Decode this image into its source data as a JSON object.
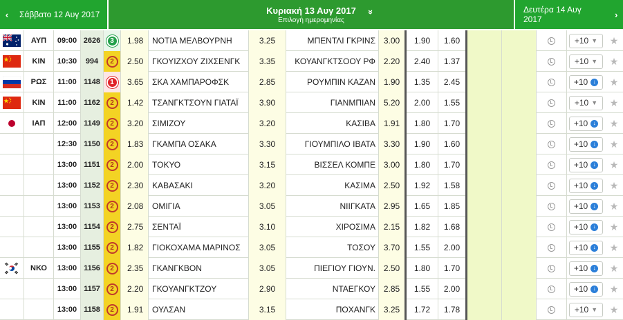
{
  "header": {
    "prev_label": "Σάββατο 12 Αυγ 2017",
    "prev_arrow": "‹",
    "center_title": "Κυριακή 13 Αυγ 2017",
    "center_sub": "Επιλογή ημερομηνίας",
    "center_toggle": "»",
    "next_label": "Δευτέρα 14 Αυγ 2017",
    "next_arrow": "›"
  },
  "colors": {
    "header_green": "#21a52f",
    "badge_yellow": "#f3d324",
    "badge_red": "#e0242a",
    "badge_green": "#22a04a",
    "odd_bg": "#fdfde4",
    "extra_bg": "#f0f9c8",
    "button_blue": "#2b7fd9"
  },
  "rows": [
    {
      "flag": "au-flag-icon",
      "country": "ΑΥΠ",
      "time": "09:00",
      "code": "2626",
      "badge": "3",
      "badge_color": "green",
      "odd1": "1.98",
      "home": "ΝΟΤΙΑ ΜΕΛΒΟΥΡΝΗ",
      "draw": "3.25",
      "away": "ΜΠΕΝΤΛΙ ΓΚΡΙΝΣ",
      "odd2": "3.00",
      "dc1": "1.90",
      "dc2": "1.60",
      "more": "+10",
      "more_icon": "chevron-down-icon"
    },
    {
      "flag": "cn-flag-icon",
      "country": "ΚΙΝ",
      "time": "10:30",
      "code": "994",
      "badge": "2",
      "badge_color": "yellow",
      "odd1": "2.50",
      "home": "ΓΚΟΥΙΖΧΟΥ ΖΙΧΣΕΝΓΚ",
      "draw": "3.35",
      "away": "ΚΟΥΑΝΓΚΤΣΟΟΥ ΡΦ",
      "odd2": "2.20",
      "dc1": "2.40",
      "dc2": "1.37",
      "more": "+10",
      "more_icon": "chevron-down-icon"
    },
    {
      "flag": "ru-flag-icon",
      "country": "ΡΩΣ",
      "time": "11:00",
      "code": "1148",
      "badge": "1",
      "badge_color": "red",
      "odd1": "3.65",
      "home": "ΣΚΑ ΧΑΜΠΑΡΟΦΣΚ",
      "draw": "2.85",
      "away": "ΡΟΥΜΠΙΝ ΚΑΖΑΝ",
      "odd2": "1.90",
      "dc1": "1.35",
      "dc2": "2.45",
      "more": "+10",
      "more_icon": "download-icon"
    },
    {
      "flag": "cn-flag-icon",
      "country": "ΚΙΝ",
      "time": "11:00",
      "code": "1162",
      "badge": "2",
      "badge_color": "yellow",
      "odd1": "1.42",
      "home": "ΤΣΑΝΓΚΤΣΟΥΝ ΓΙΑΤΑΪ",
      "draw": "3.90",
      "away": "ΓΙΑΝΜΠΙΑΝ",
      "odd2": "5.20",
      "dc1": "2.00",
      "dc2": "1.55",
      "more": "+10",
      "more_icon": "chevron-down-icon"
    },
    {
      "flag": "jp-flag-icon",
      "country": "ΙΑΠ",
      "time": "12:00",
      "code": "1149",
      "badge": "2",
      "badge_color": "yellow",
      "odd1": "3.20",
      "home": "ΣΙΜΙΖΟΥ",
      "draw": "3.20",
      "away": "ΚΑΣΙΒΑ",
      "odd2": "1.91",
      "dc1": "1.80",
      "dc2": "1.70",
      "more": "+10",
      "more_icon": "download-icon"
    },
    {
      "flag": "",
      "country": "",
      "time": "12:30",
      "code": "1150",
      "badge": "2",
      "badge_color": "yellow",
      "odd1": "1.83",
      "home": "ΓΚΑΜΠΑ ΟΣΑΚΑ",
      "draw": "3.30",
      "away": "ΓΙΟΥΜΠΙΛΟ ΙΒΑΤΑ",
      "odd2": "3.30",
      "dc1": "1.90",
      "dc2": "1.60",
      "more": "+10",
      "more_icon": "download-icon"
    },
    {
      "flag": "",
      "country": "",
      "time": "13:00",
      "code": "1151",
      "badge": "2",
      "badge_color": "yellow",
      "odd1": "2.00",
      "home": "ΤΟΚΥΟ",
      "draw": "3.15",
      "away": "ΒΙΣΣΕΛ ΚΟΜΠΕ",
      "odd2": "3.00",
      "dc1": "1.80",
      "dc2": "1.70",
      "more": "+10",
      "more_icon": "download-icon"
    },
    {
      "flag": "",
      "country": "",
      "time": "13:00",
      "code": "1152",
      "badge": "2",
      "badge_color": "yellow",
      "odd1": "2.30",
      "home": "ΚΑΒΑΣΑΚΙ",
      "draw": "3.20",
      "away": "ΚΑΣΙΜΑ",
      "odd2": "2.50",
      "dc1": "1.92",
      "dc2": "1.58",
      "more": "+10",
      "more_icon": "download-icon"
    },
    {
      "flag": "",
      "country": "",
      "time": "13:00",
      "code": "1153",
      "badge": "2",
      "badge_color": "yellow",
      "odd1": "2.08",
      "home": "ΟΜΙΓΙΑ",
      "draw": "3.05",
      "away": "ΝΙΙΓΚΑΤΑ",
      "odd2": "2.95",
      "dc1": "1.65",
      "dc2": "1.85",
      "more": "+10",
      "more_icon": "download-icon"
    },
    {
      "flag": "",
      "country": "",
      "time": "13:00",
      "code": "1154",
      "badge": "2",
      "badge_color": "yellow",
      "odd1": "2.75",
      "home": "ΣΕΝΤΑΪ",
      "draw": "3.10",
      "away": "ΧΙΡΟΣΙΜΑ",
      "odd2": "2.15",
      "dc1": "1.82",
      "dc2": "1.68",
      "more": "+10",
      "more_icon": "download-icon"
    },
    {
      "flag": "",
      "country": "",
      "time": "13:00",
      "code": "1155",
      "badge": "2",
      "badge_color": "yellow",
      "odd1": "1.82",
      "home": "ΓΙΟΚΟΧΑΜΑ ΜΑΡΙΝΟΣ",
      "draw": "3.05",
      "away": "ΤΟΣΟΥ",
      "odd2": "3.70",
      "dc1": "1.55",
      "dc2": "2.00",
      "more": "+10",
      "more_icon": "download-icon"
    },
    {
      "flag": "kr-flag-icon",
      "country": "ΝΚΟ",
      "time": "13:00",
      "code": "1156",
      "badge": "2",
      "badge_color": "yellow",
      "odd1": "2.35",
      "home": "ΓΚΑΝΓΚΒΟΝ",
      "draw": "3.05",
      "away": "ΠΙΕΓΙΟΥ ΓΙΟΥΝ.",
      "odd2": "2.50",
      "dc1": "1.80",
      "dc2": "1.70",
      "more": "+10",
      "more_icon": "download-icon"
    },
    {
      "flag": "",
      "country": "",
      "time": "13:00",
      "code": "1157",
      "badge": "2",
      "badge_color": "yellow",
      "odd1": "2.20",
      "home": "ΓΚΟΥΑΝΓΚΤΖΟΥ",
      "draw": "2.90",
      "away": "ΝΤΑΕΓΚΟΥ",
      "odd2": "2.85",
      "dc1": "1.55",
      "dc2": "2.00",
      "more": "+10",
      "more_icon": "download-icon"
    },
    {
      "flag": "",
      "country": "",
      "time": "13:00",
      "code": "1158",
      "badge": "2",
      "badge_color": "yellow",
      "odd1": "1.91",
      "home": "ΟΥΛΣΑΝ",
      "draw": "3.15",
      "away": "ΠΟΧΑΝΓΚ",
      "odd2": "3.25",
      "dc1": "1.72",
      "dc2": "1.78",
      "more": "+10",
      "more_icon": "chevron-down-icon"
    }
  ]
}
